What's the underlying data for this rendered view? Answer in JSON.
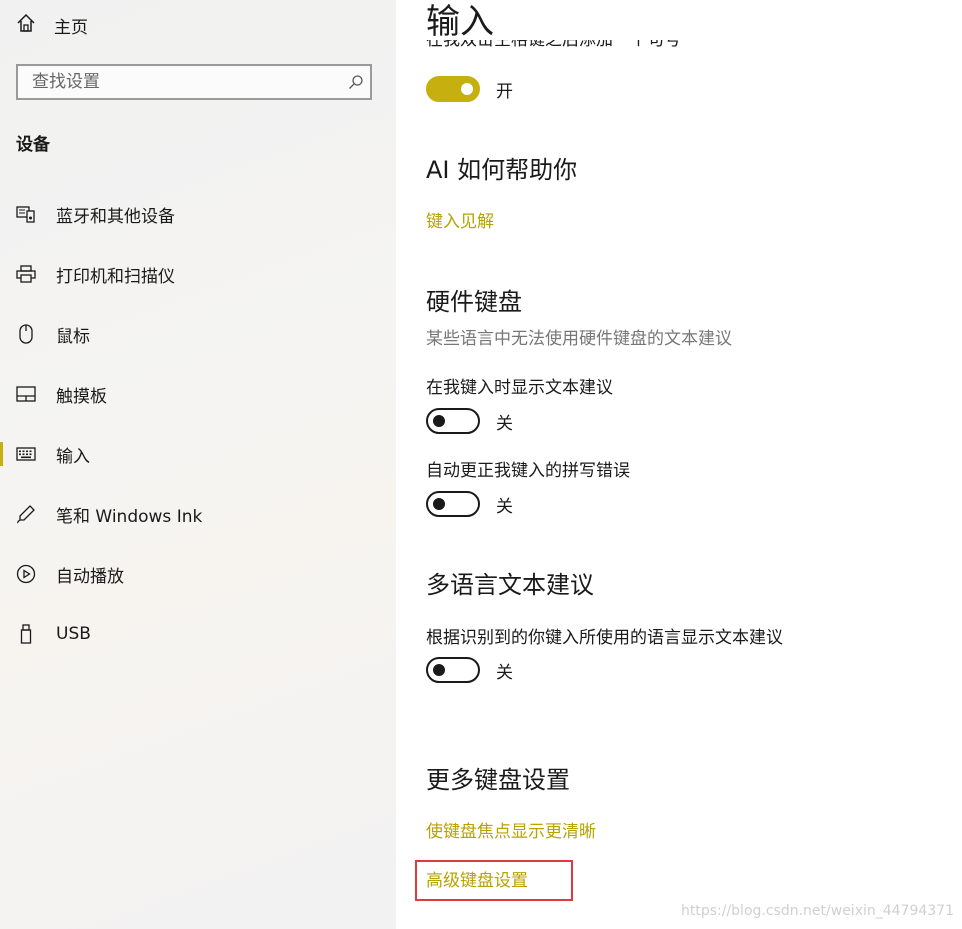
{
  "sidebar": {
    "home_label": "主页",
    "search_placeholder": "查找设置",
    "section_title": "设备",
    "items": [
      {
        "label": "蓝牙和其他设备",
        "icon": "bluetooth-devices-icon"
      },
      {
        "label": "打印机和扫描仪",
        "icon": "printer-icon"
      },
      {
        "label": "鼠标",
        "icon": "mouse-icon"
      },
      {
        "label": "触摸板",
        "icon": "touchpad-icon"
      },
      {
        "label": "输入",
        "icon": "keyboard-icon",
        "active": true
      },
      {
        "label": "笔和 Windows Ink",
        "icon": "pen-icon"
      },
      {
        "label": "自动播放",
        "icon": "autoplay-icon"
      },
      {
        "label": "USB",
        "icon": "usb-icon"
      }
    ]
  },
  "main": {
    "title": "输入",
    "clipped_text": "在我双击空格键之后添加一个句号",
    "top_toggle_state": "开",
    "ai_section_title": "AI 如何帮助你",
    "ai_link": "键入见解",
    "hw_section_title": "硬件键盘",
    "hw_description": "某些语言中无法使用硬件键盘的文本建议",
    "hw_setting1_label": "在我键入时显示文本建议",
    "hw_setting1_state": "关",
    "hw_setting2_label": "自动更正我键入的拼写错误",
    "hw_setting2_state": "关",
    "ml_section_title": "多语言文本建议",
    "ml_setting_label": "根据识别到的你键入所使用的语言显示文本建议",
    "ml_setting_state": "关",
    "more_section_title": "更多键盘设置",
    "more_link1": "使键盘焦点显示更清晰",
    "more_link2": "高级键盘设置"
  },
  "watermark": "https://blog.csdn.net/weixin_44794371",
  "colors": {
    "accent": "#c6b00f",
    "link": "#b8a300",
    "highlight": "#e0393e"
  }
}
